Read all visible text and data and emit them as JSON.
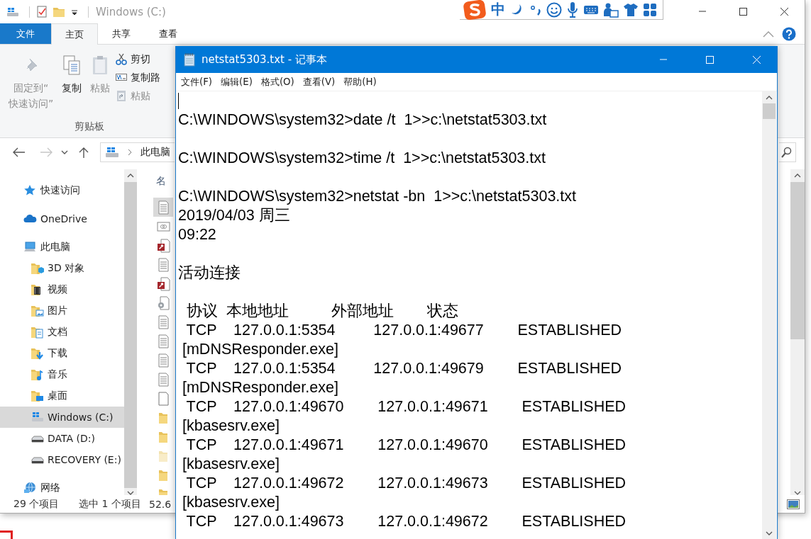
{
  "explorer": {
    "title": "Windows (C:)",
    "ribbon_tabs": [
      {
        "label": "文件",
        "kind": "file",
        "selected": false
      },
      {
        "label": "主页",
        "kind": "tab",
        "selected": true
      },
      {
        "label": "共享",
        "kind": "tab",
        "selected": false
      },
      {
        "label": "查看",
        "kind": "tab",
        "selected": false
      }
    ],
    "ribbon": {
      "large_buttons": [
        {
          "label": "固定到“\n快速访问”",
          "kind": "pin",
          "disabled": true
        },
        {
          "label": "复制",
          "kind": "copy",
          "disabled": false
        },
        {
          "label": "粘贴",
          "kind": "paste",
          "disabled": true
        }
      ],
      "small_buttons": [
        {
          "label": "剪切",
          "kind": "cut",
          "disabled": false
        },
        {
          "label": "复制路",
          "kind": "copy-path",
          "disabled": false
        },
        {
          "label": "粘贴",
          "kind": "paste-shortcut",
          "disabled": true
        }
      ],
      "group_label": "剪贴板"
    },
    "address": {
      "path": "此电脑"
    },
    "nav_items": [
      {
        "label": "快速访问",
        "kind": "star",
        "selected": false
      },
      {
        "label": "OneDrive",
        "kind": "cloud",
        "selected": false
      },
      {
        "label": "此电脑",
        "kind": "pc",
        "selected": false,
        "children": [
          {
            "label": "3D 对象",
            "kind": "folder-3d",
            "selected": false
          },
          {
            "label": "视频",
            "kind": "folder-video",
            "selected": false
          },
          {
            "label": "图片",
            "kind": "folder-pictures",
            "selected": false
          },
          {
            "label": "文档",
            "kind": "folder-docs",
            "selected": false
          },
          {
            "label": "下载",
            "kind": "folder-downloads",
            "selected": false
          },
          {
            "label": "音乐",
            "kind": "folder-music",
            "selected": false
          },
          {
            "label": "桌面",
            "kind": "folder-desktop",
            "selected": false
          },
          {
            "label": "Windows (C:)",
            "kind": "drive-windows",
            "selected": true
          },
          {
            "label": "DATA (D:)",
            "kind": "drive",
            "selected": false
          },
          {
            "label": "RECOVERY (E:)",
            "kind": "drive",
            "selected": false
          }
        ]
      },
      {
        "label": "网络",
        "kind": "network",
        "selected": false
      }
    ],
    "file_list": {
      "column_1": "名",
      "files": [
        {
          "kind": "text",
          "selected": true
        },
        {
          "kind": "link",
          "selected": false
        },
        {
          "kind": "key-doc",
          "selected": false
        },
        {
          "kind": "text",
          "selected": false
        },
        {
          "kind": "key-doc",
          "selected": false
        },
        {
          "kind": "gear-doc",
          "selected": false
        },
        {
          "kind": "text",
          "selected": false
        },
        {
          "kind": "text",
          "selected": false
        },
        {
          "kind": "text",
          "selected": false
        },
        {
          "kind": "text",
          "selected": false
        },
        {
          "kind": "blank",
          "selected": false
        },
        {
          "kind": "folder",
          "selected": false
        },
        {
          "kind": "folder",
          "selected": false
        },
        {
          "kind": "folder-faded",
          "selected": false
        },
        {
          "kind": "folder",
          "selected": false
        },
        {
          "kind": "folder",
          "selected": false
        }
      ]
    },
    "status_bar": {
      "item_count": "29 个项目",
      "selection": "选中 1 个项目",
      "size": "52.6"
    }
  },
  "ime_toolbar": {
    "mode": "中"
  },
  "notepad": {
    "title": "netstat5303.txt - 记事本",
    "menu": [
      "文件(F)",
      "编辑(E)",
      "格式(O)",
      "查看(V)",
      "帮助(H)"
    ],
    "text_cursor": true,
    "paragraphs": [
      [
        "C:\\WINDOWS\\system32>date /t  1>>c:\\netstat5303.txt"
      ],
      [
        "C:\\WINDOWS\\system32>time /t  1>>c:\\netstat5303.txt"
      ],
      [
        "C:\\WINDOWS\\system32>netstat -bn  1>>c:\\netstat5303.txt",
        "2019/04/03 周三",
        "09:22"
      ],
      [
        "活动连接"
      ],
      [
        "  协议  本地地址          外部地址        状态",
        "  TCP    127.0.0.1:5354         127.0.0.1:49677        ESTABLISHED",
        " [mDNSResponder.exe]",
        "  TCP    127.0.0.1:5354         127.0.0.1:49679        ESTABLISHED",
        " [mDNSResponder.exe]",
        "  TCP    127.0.0.1:49670        127.0.0.1:49671        ESTABLISHED",
        " [kbasesrv.exe]",
        "  TCP    127.0.0.1:49671        127.0.0.1:49670        ESTABLISHED",
        " [kbasesrv.exe]",
        "  TCP    127.0.0.1:49672        127.0.0.1:49673        ESTABLISHED",
        " [kbasesrv.exe]",
        "  TCP    127.0.0.1:49673        127.0.0.1:49672        ESTABLISHED"
      ]
    ]
  }
}
